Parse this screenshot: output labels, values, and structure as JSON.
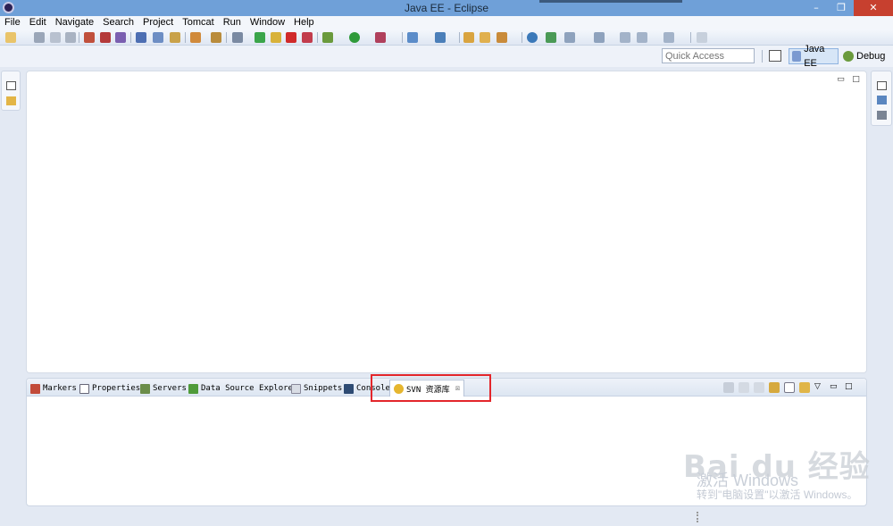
{
  "window": {
    "title": "Java EE - Eclipse",
    "minimize_glyph": "–",
    "restore_glyph": "❐",
    "close_glyph": "✕"
  },
  "menu": [
    "File",
    "Edit",
    "Navigate",
    "Search",
    "Project",
    "Tomcat",
    "Run",
    "Window",
    "Help"
  ],
  "quick_access": {
    "placeholder": "Quick Access"
  },
  "perspectives": {
    "active": "Java EE",
    "other": "Debug"
  },
  "editor": {
    "minimize_glyph": "▭",
    "maximize_glyph": "□"
  },
  "panel": {
    "tabs": [
      "Markers",
      "Properties",
      "Servers",
      "Data Source Explorer",
      "Snippets",
      "Console",
      "SVN 资源库"
    ],
    "active_tab": "SVN 资源库",
    "close_glyph": "☒"
  },
  "watermarks": {
    "activate_title": "激活 Windows",
    "activate_sub": "转到\"电脑设置\"以激活 Windows。",
    "baidu": "Bai du 经验"
  },
  "colors": {
    "titlebar": "#6fa0d8",
    "highlight": "#e3262b",
    "close_button": "#c7402f"
  }
}
